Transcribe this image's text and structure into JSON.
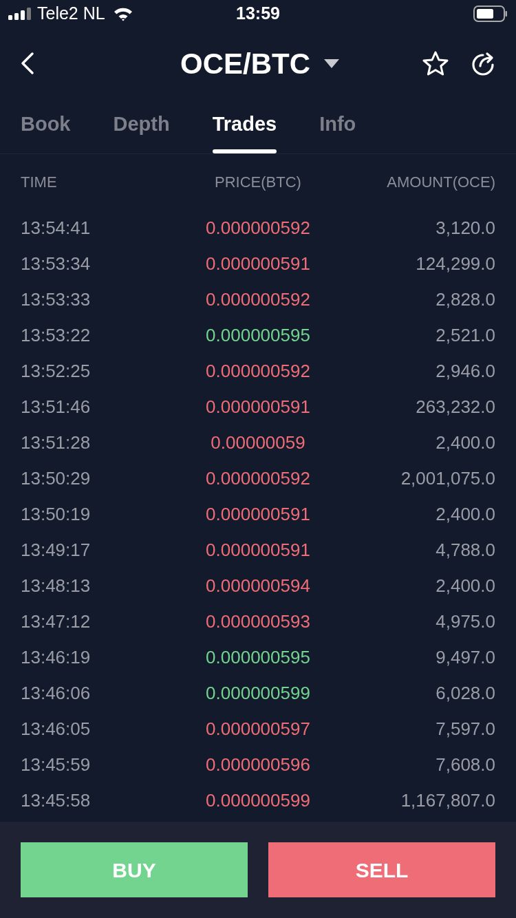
{
  "status_bar": {
    "carrier": "Tele2 NL",
    "time": "13:59"
  },
  "header": {
    "title": "OCE/BTC"
  },
  "tabs": [
    {
      "label": "Book",
      "selected": false
    },
    {
      "label": "Depth",
      "selected": false
    },
    {
      "label": "Trades",
      "selected": true
    },
    {
      "label": "Info",
      "selected": false
    }
  ],
  "table": {
    "columns": [
      "TIME",
      "PRICE(BTC)",
      "AMOUNT(OCE)"
    ],
    "rows": [
      {
        "time": "13:54:41",
        "price": "0.000000592",
        "amount": "3,120.0",
        "color": "#ee6d76"
      },
      {
        "time": "13:53:34",
        "price": "0.000000591",
        "amount": "124,299.0",
        "color": "#ee6d76"
      },
      {
        "time": "13:53:33",
        "price": "0.000000592",
        "amount": "2,828.0",
        "color": "#ee6d76"
      },
      {
        "time": "13:53:22",
        "price": "0.000000595",
        "amount": "2,521.0",
        "color": "#72d48f"
      },
      {
        "time": "13:52:25",
        "price": "0.000000592",
        "amount": "2,946.0",
        "color": "#ee6d76"
      },
      {
        "time": "13:51:46",
        "price": "0.000000591",
        "amount": "263,232.0",
        "color": "#ee6d76"
      },
      {
        "time": "13:51:28",
        "price": "0.00000059",
        "amount": "2,400.0",
        "color": "#ee6d76"
      },
      {
        "time": "13:50:29",
        "price": "0.000000592",
        "amount": "2,001,075.0",
        "color": "#ee6d76"
      },
      {
        "time": "13:50:19",
        "price": "0.000000591",
        "amount": "2,400.0",
        "color": "#ee6d76"
      },
      {
        "time": "13:49:17",
        "price": "0.000000591",
        "amount": "4,788.0",
        "color": "#ee6d76"
      },
      {
        "time": "13:48:13",
        "price": "0.000000594",
        "amount": "2,400.0",
        "color": "#ee6d76"
      },
      {
        "time": "13:47:12",
        "price": "0.000000593",
        "amount": "4,975.0",
        "color": "#ee6d76"
      },
      {
        "time": "13:46:19",
        "price": "0.000000595",
        "amount": "9,497.0",
        "color": "#72d48f"
      },
      {
        "time": "13:46:06",
        "price": "0.000000599",
        "amount": "6,028.0",
        "color": "#72d48f"
      },
      {
        "time": "13:46:05",
        "price": "0.000000597",
        "amount": "7,597.0",
        "color": "#ee6d76"
      },
      {
        "time": "13:45:59",
        "price": "0.000000596",
        "amount": "7,608.0",
        "color": "#ee6d76"
      },
      {
        "time": "13:45:58",
        "price": "0.000000599",
        "amount": "1,167,807.0",
        "color": "#ee6d76"
      }
    ]
  },
  "actions": {
    "buy": "BUY",
    "sell": "SELL"
  }
}
